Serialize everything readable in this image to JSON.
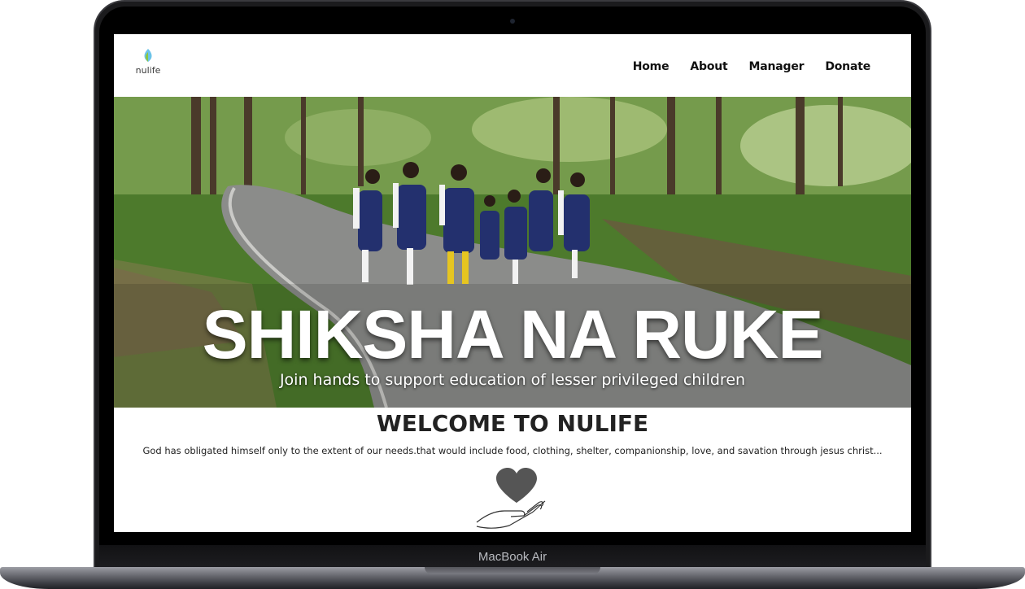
{
  "device": {
    "model_label": "MacBook Air"
  },
  "site": {
    "logo_text": "nulife",
    "nav": [
      "Home",
      "About",
      "Manager",
      "Donate"
    ]
  },
  "hero": {
    "title": "SHIKSHA NA RUKE",
    "subtitle": "Join hands to support education of lesser privileged children"
  },
  "welcome": {
    "title": "WELCOME TO NULIFE",
    "text": "God has obligated himself only to the extent of our needs.that would include food, clothing, shelter, companionship, love, and savation through jesus christ..."
  },
  "colors": {
    "uniform": "#23306e",
    "foliage": "#4f7a31",
    "heart": "#555555"
  },
  "icons": {
    "logo": "leaf-drop-icon",
    "donate_graphic": "hand-holding-heart-icon"
  }
}
